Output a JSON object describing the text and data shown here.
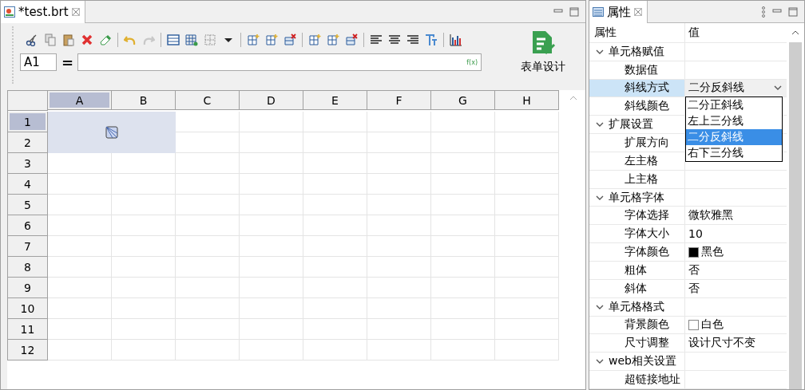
{
  "editor": {
    "tab": {
      "title": "*test.brt",
      "selected": true
    },
    "toolbar": [
      [
        {
          "kind": "cut",
          "disabled": false
        },
        {
          "kind": "copy",
          "disabled": false
        },
        {
          "kind": "paste",
          "disabled": false
        },
        {
          "kind": "delete",
          "disabled": false
        },
        {
          "kind": "eraser",
          "disabled": false
        }
      ],
      [
        {
          "kind": "undo",
          "disabled": false
        },
        {
          "kind": "redo",
          "disabled": true
        }
      ],
      [
        {
          "kind": "text-cell",
          "disabled": false
        },
        {
          "kind": "grid-gear",
          "disabled": false
        },
        {
          "kind": "borders",
          "disabled": false
        },
        {
          "kind": "caret",
          "disabled": false
        }
      ],
      [
        {
          "kind": "insert-col-left",
          "disabled": false
        },
        {
          "kind": "insert-col-right",
          "disabled": false
        },
        {
          "kind": "delete-col",
          "disabled": false
        }
      ],
      [
        {
          "kind": "insert-row-above",
          "disabled": false
        },
        {
          "kind": "insert-row-below",
          "disabled": false
        },
        {
          "kind": "delete-row",
          "disabled": false
        }
      ],
      [
        {
          "kind": "align-left",
          "disabled": false
        },
        {
          "kind": "align-center",
          "disabled": false
        },
        {
          "kind": "align-right",
          "disabled": false
        },
        {
          "kind": "font",
          "disabled": false
        }
      ],
      [
        {
          "kind": "chart",
          "disabled": false
        }
      ]
    ],
    "cell_ref": "A1",
    "equals": "=",
    "formula_hint": "f(x)",
    "form_design": "表单设计",
    "grid": {
      "columns": [
        {
          "label": "A",
          "selected": true
        },
        {
          "label": "B",
          "selected": false
        },
        {
          "label": "C",
          "selected": false
        },
        {
          "label": "D",
          "selected": false
        },
        {
          "label": "E",
          "selected": false
        },
        {
          "label": "F",
          "selected": false
        },
        {
          "label": "G",
          "selected": false
        },
        {
          "label": "H",
          "selected": false
        }
      ],
      "rows": [
        {
          "label": "1",
          "selected": true
        },
        {
          "label": "2",
          "selected": false
        },
        {
          "label": "3",
          "selected": false
        },
        {
          "label": "4",
          "selected": false
        },
        {
          "label": "5",
          "selected": false
        },
        {
          "label": "6",
          "selected": false
        },
        {
          "label": "7",
          "selected": false
        },
        {
          "label": "8",
          "selected": false
        },
        {
          "label": "9",
          "selected": false
        },
        {
          "label": "10",
          "selected": false
        },
        {
          "label": "11",
          "selected": false
        },
        {
          "label": "12",
          "selected": false
        }
      ],
      "merged": {
        "kind": "diagonal"
      }
    }
  },
  "properties": {
    "tab": {
      "title": "属性",
      "selected": true
    },
    "header": [
      "属性",
      "值"
    ],
    "rows": [
      {
        "kind": "group",
        "name": "单元格赋值",
        "expanded": true,
        "selected": false
      },
      {
        "kind": "prop",
        "name": "数据值",
        "selected": false
      },
      {
        "kind": "select",
        "name": "斜线方式",
        "value": "二分反斜线",
        "selected": true,
        "options": [
          {
            "label": "二分正斜线",
            "selected": false
          },
          {
            "label": "左上三分线",
            "selected": false
          },
          {
            "label": "二分反斜线",
            "selected": true
          },
          {
            "label": "右下三分线",
            "selected": false
          }
        ]
      },
      {
        "kind": "prop",
        "name": "斜线颜色",
        "selected": false
      },
      {
        "kind": "group",
        "name": "扩展设置",
        "expanded": true,
        "selected": false
      },
      {
        "kind": "prop",
        "name": "扩展方向",
        "selected": false
      },
      {
        "kind": "prop",
        "name": "左主格",
        "selected": false
      },
      {
        "kind": "prop",
        "name": "上主格",
        "selected": false
      },
      {
        "kind": "group",
        "name": "单元格字体",
        "expanded": true,
        "selected": false
      },
      {
        "kind": "prop",
        "name": "字体选择",
        "value": "微软雅黑",
        "selected": false
      },
      {
        "kind": "prop",
        "name": "字体大小",
        "value": "10",
        "selected": false
      },
      {
        "kind": "prop",
        "name": "字体颜色",
        "value": "黑色",
        "color": "#000000",
        "selected": false
      },
      {
        "kind": "prop",
        "name": "粗体",
        "value": "否",
        "selected": false
      },
      {
        "kind": "prop",
        "name": "斜体",
        "value": "否",
        "selected": false
      },
      {
        "kind": "group",
        "name": "单元格格式",
        "expanded": true,
        "selected": false
      },
      {
        "kind": "prop",
        "name": "背景颜色",
        "value": "白色",
        "color": "#ffffff",
        "selected": false
      },
      {
        "kind": "prop",
        "name": "尺寸调整",
        "value": "设计尺寸不变",
        "selected": false
      },
      {
        "kind": "group",
        "name": "web相关设置",
        "expanded": true,
        "selected": false
      },
      {
        "kind": "prop",
        "name": "超链接地址",
        "selected": false
      }
    ]
  }
}
